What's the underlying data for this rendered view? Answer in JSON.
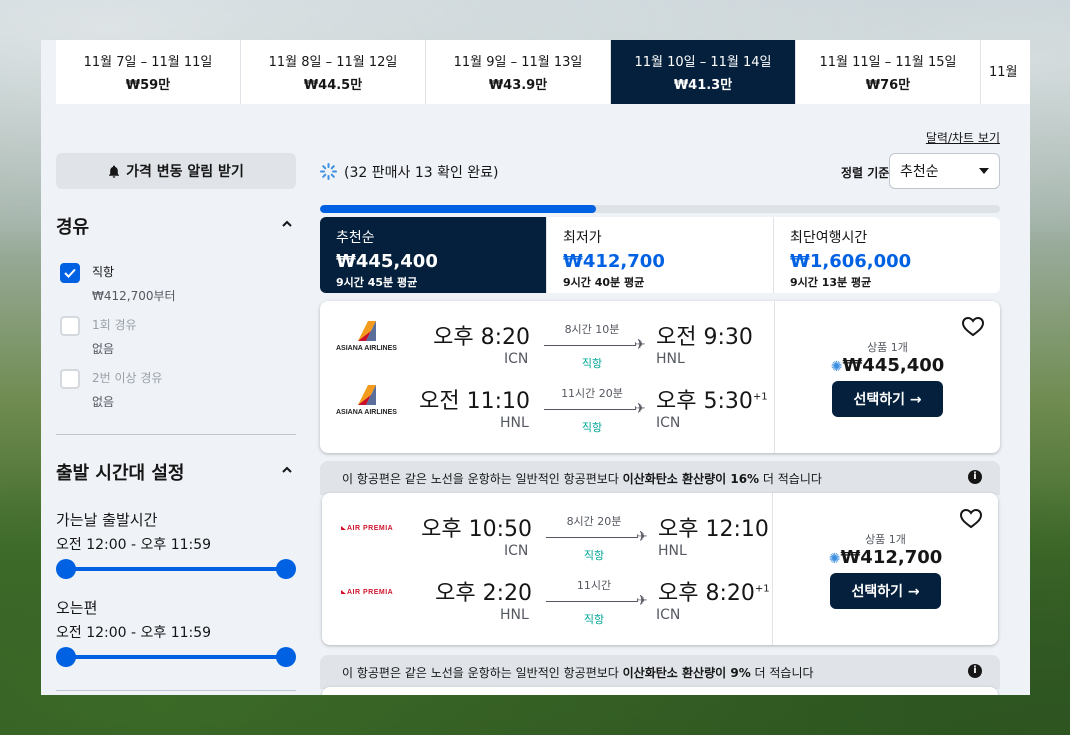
{
  "date_tabs": [
    {
      "dates": "11월 7일 – 11월 11일",
      "price": "₩59만",
      "active": false
    },
    {
      "dates": "11월 8일 – 11월 12일",
      "price": "₩44.5만",
      "active": false
    },
    {
      "dates": "11월 9일 – 11월 13일",
      "price": "₩43.9만",
      "active": false
    },
    {
      "dates": "11월 10일 – 11월 14일",
      "price": "₩41.3만",
      "active": true
    },
    {
      "dates": "11월 11일 – 11월 15일",
      "price": "₩76만",
      "active": false
    },
    {
      "dates": "11월",
      "price": "",
      "active": false
    }
  ],
  "calendar_link": "달력/차트 보기",
  "sidebar": {
    "alert_button": "가격 변동 알림 받기",
    "stops_title": "경유",
    "stops": [
      {
        "label": "직항",
        "sub": "₩412,700부터",
        "checked": true,
        "enabled": true
      },
      {
        "label": "1회 경유",
        "sub": "없음",
        "checked": false,
        "enabled": false
      },
      {
        "label": "2번 이상 경유",
        "sub": "없음",
        "checked": false,
        "enabled": false
      }
    ],
    "time_title": "출발 시간대 설정",
    "outbound_label": "가는날 출발시간",
    "outbound_range": "오전 12:00 - 오후 11:59",
    "return_label": "오는편",
    "return_range": "오전 12:00 - 오후 11:59"
  },
  "main": {
    "progress_text": "(32 판매사 13 확인 완료)",
    "progress_fraction": 0.406,
    "sort_label": "정렬 기준",
    "sort_value": "추천순",
    "sort_tabs": [
      {
        "name": "추천순",
        "price": "₩445,400",
        "avg": "9시간 45분 평균",
        "active": true
      },
      {
        "name": "최저가",
        "price": "₩412,700",
        "avg": "9시간 40분 평균",
        "active": false
      },
      {
        "name": "최단여행시간",
        "price": "₩1,606,000",
        "avg": "9시간 13분 평균",
        "active": false
      }
    ],
    "cards": [
      {
        "airline": "ASIANA AIRLINES",
        "banner": null,
        "legs": [
          {
            "dep": "오후 8:20",
            "dep_code": "ICN",
            "dur": "8시간 10분",
            "type": "직항",
            "arr": "오전 9:30",
            "arr_code": "HNL",
            "plus": ""
          },
          {
            "dep": "오전 11:10",
            "dep_code": "HNL",
            "dur": "11시간 20분",
            "type": "직항",
            "arr": "오후 5:30",
            "arr_code": "ICN",
            "plus": "+1"
          }
        ],
        "deals": "상품 1개",
        "price": "₩445,400",
        "button": "선택하기 →"
      },
      {
        "airline": "AIR PREMIA",
        "banner": {
          "pre": "이 항공편은 같은 노선을 운항하는 일반적인 항공편보다 ",
          "bold": "이산화탄소 환산량이 16%",
          "post": " 더 적습니다"
        },
        "legs": [
          {
            "dep": "오후 10:50",
            "dep_code": "ICN",
            "dur": "8시간 20분",
            "type": "직항",
            "arr": "오후 12:10",
            "arr_code": "HNL",
            "plus": ""
          },
          {
            "dep": "오후 2:20",
            "dep_code": "HNL",
            "dur": "11시간",
            "type": "직항",
            "arr": "오후 8:20",
            "arr_code": "ICN",
            "plus": "+1"
          }
        ],
        "deals": "상품 1개",
        "price": "₩412,700",
        "button": "선택하기 →"
      }
    ],
    "third_banner": {
      "pre": "이 항공편은 같은 노선을 운항하는 일반적인 항공편보다 ",
      "bold": "이산화탄소 환산량이 9%",
      "post": " 더 적습니다"
    }
  },
  "colors": {
    "accent": "#0062e3",
    "dark": "#05203c",
    "direct": "#00a698"
  }
}
